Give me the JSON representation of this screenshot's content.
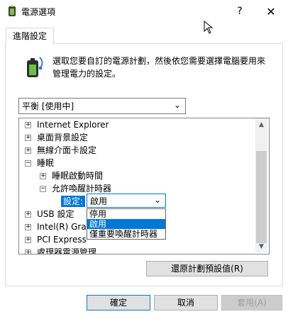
{
  "window": {
    "title": "電源選項",
    "help_label": "?",
    "close_label": "✕"
  },
  "tab": {
    "label": "進階設定"
  },
  "description": "選取您要自訂的電源計劃，然後依您需要選擇電腦要用來管理電力的設定。",
  "plan_select": {
    "value": "平衡 [使用中]"
  },
  "tree": {
    "items": [
      {
        "label": "Internet Explorer",
        "expander": "+"
      },
      {
        "label": "桌面背景設定",
        "expander": "+"
      },
      {
        "label": "無線介面卡設定",
        "expander": "+"
      },
      {
        "label": "睡眠",
        "expander": "−"
      },
      {
        "label": "睡眠啟動時間",
        "expander": "+"
      },
      {
        "label": "允許喚醒計時器",
        "expander": "−"
      },
      {
        "label": "USB 設定",
        "expander": "+"
      },
      {
        "label": "Intel(R) Grap",
        "expander": "+"
      },
      {
        "label": "PCI Express",
        "expander": "+"
      },
      {
        "label": "處理器電源管理",
        "expander": "+"
      }
    ],
    "setting_label": "設定:",
    "setting_value": "啟用"
  },
  "dropdown": {
    "options": [
      "停用",
      "啟用",
      "僅重要喚醒計時器"
    ],
    "selected_index": 1
  },
  "buttons": {
    "restore": "還原計劃預設值(R)",
    "ok": "確定",
    "cancel": "取消",
    "apply": "套用(A)"
  },
  "colors": {
    "accent": "#0078d7"
  }
}
